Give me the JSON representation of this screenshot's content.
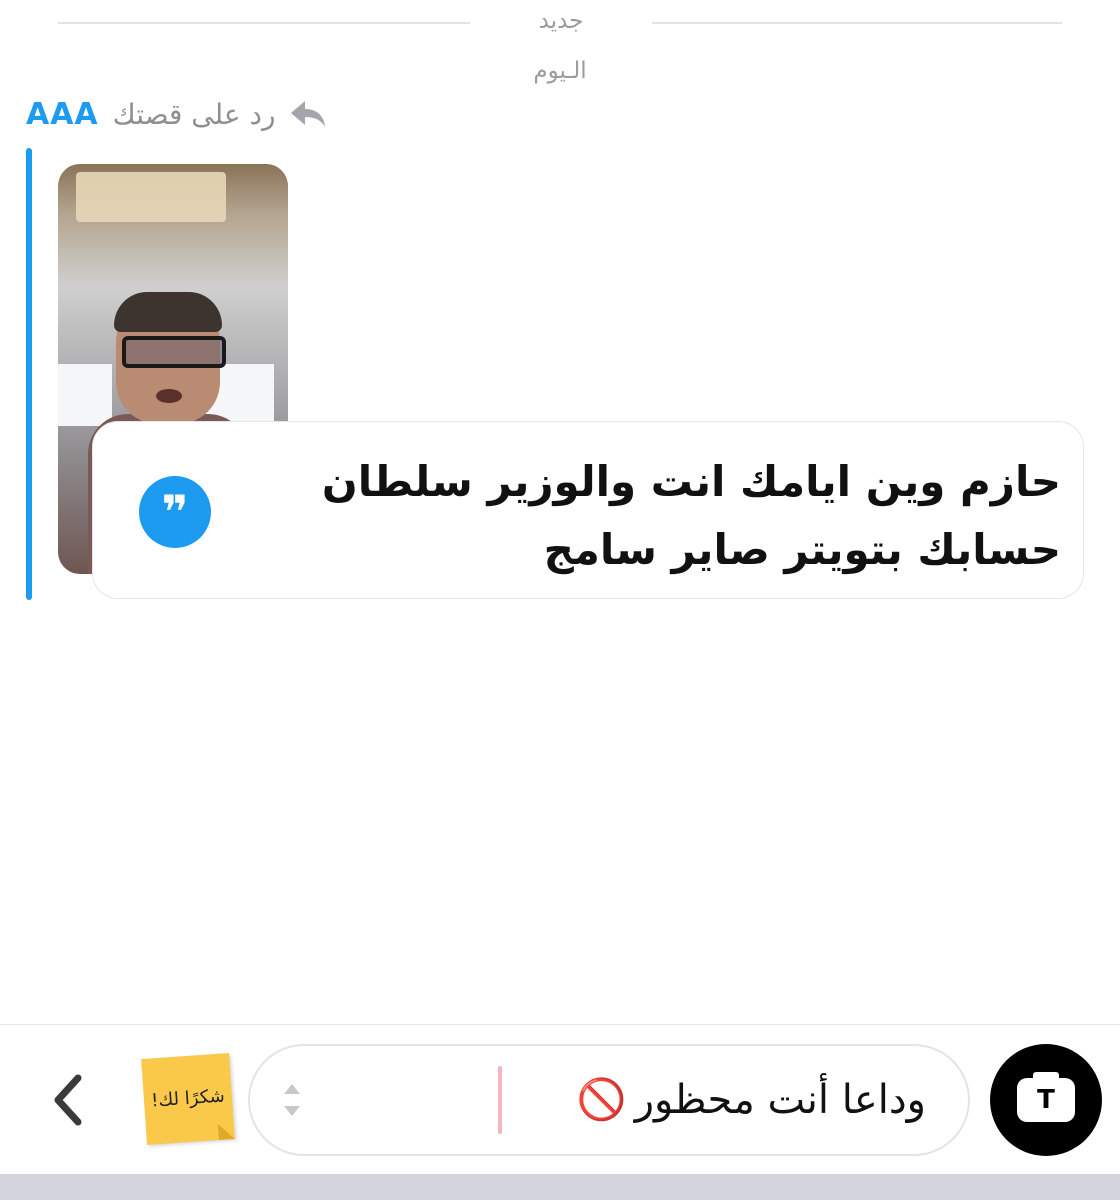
{
  "divider": {
    "new_label": "جديد"
  },
  "day": {
    "label": "الـيوم"
  },
  "reply": {
    "prefix": "رد على قصتك",
    "user": "AAA"
  },
  "quote": {
    "text": "حازم وين ايامك انت والوزير سلطان حسابك بتويتر صاير سامج",
    "icon": "quote-icon"
  },
  "composer": {
    "input_value": "وداعا أنت محظور",
    "blocked_emoji": "🚫",
    "sticker_text": "شكرًا لك!",
    "camera_glyph": "T"
  },
  "colors": {
    "accent": "#1d9bf0",
    "sticker": "#fbc94a"
  }
}
